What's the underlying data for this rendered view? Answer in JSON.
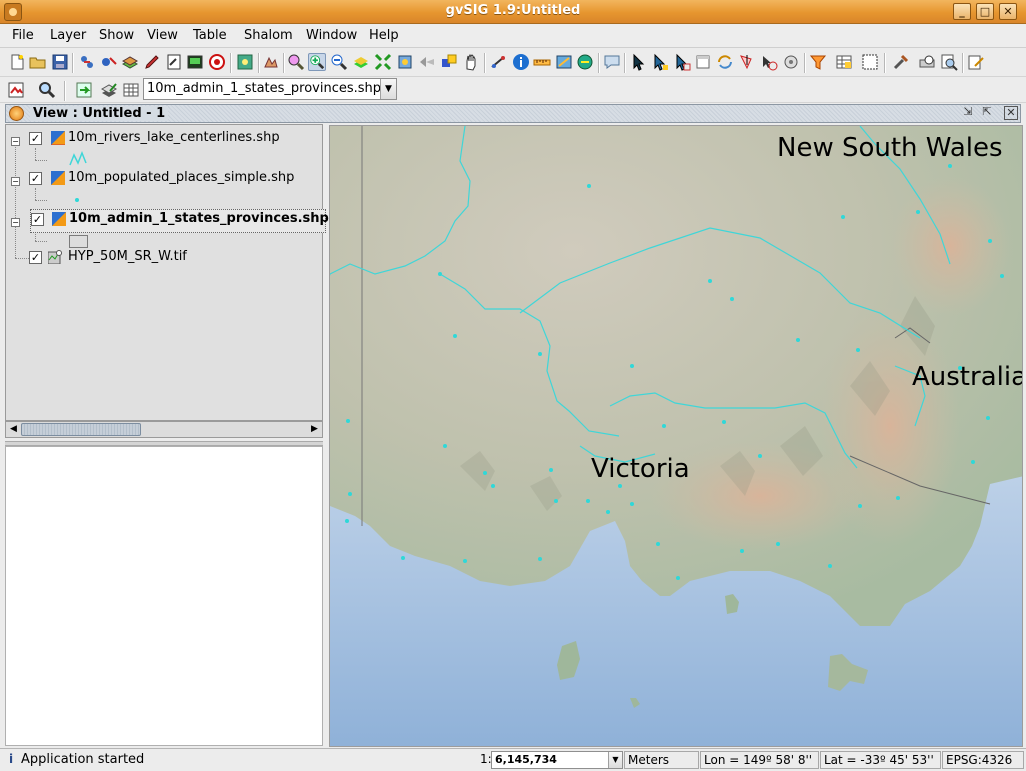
{
  "window": {
    "title": "gvSIG 1.9:Untitled",
    "controls": [
      "_",
      "□",
      "✕"
    ]
  },
  "menu": [
    "File",
    "Layer",
    "Show",
    "View",
    "Table",
    "Shalom",
    "Window",
    "Help"
  ],
  "toolbar": {
    "active_layer": "10m_admin_1_states_provinces.shp"
  },
  "view": {
    "title": "View : Untitled - 1"
  },
  "toc": {
    "layers": [
      {
        "name": "10m_rivers_lake_centerlines.shp",
        "checked": true,
        "bold": false
      },
      {
        "name": "10m_populated_places_simple.shp",
        "checked": true,
        "bold": false
      },
      {
        "name": "10m_admin_1_states_provinces.shp",
        "checked": true,
        "bold": true
      },
      {
        "name": "HYP_50M_SR_W.tif",
        "checked": true,
        "bold": false
      }
    ]
  },
  "map": {
    "labels": {
      "nsw": "New South Wales",
      "australia": "Australia",
      "victoria": "Victoria"
    },
    "colors": {
      "rivers": "#3fd6d8",
      "places": "#2fd8d8",
      "sea": "#b9cfe6",
      "land": "#c7c5b5"
    }
  },
  "status": {
    "message": "Application started",
    "scale_prefix": "1:",
    "scale": "6,145,734",
    "units": "Meters",
    "lon": "Lon = 149º 58' 8''",
    "lat": "Lat = -33º 45' 53''",
    "crs": "EPSG:4326"
  }
}
